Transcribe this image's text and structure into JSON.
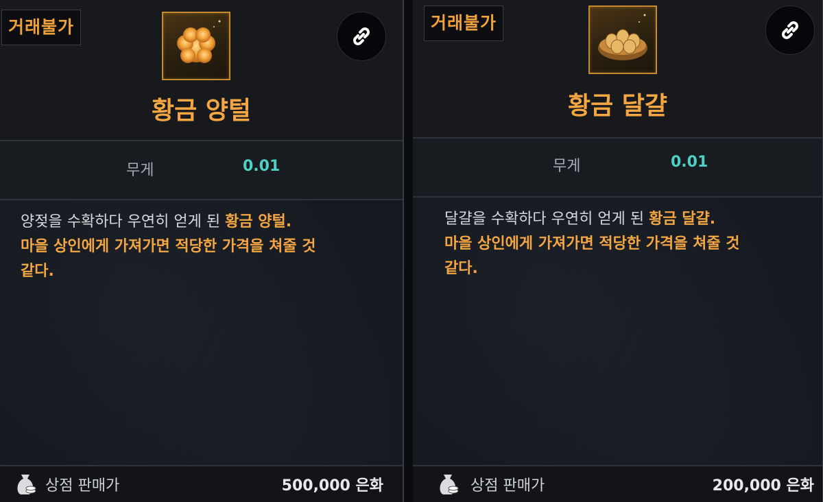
{
  "items": [
    {
      "badge": "거래불가",
      "icon": "golden-wool-icon",
      "name": "황금 양털",
      "stat_label": "무게",
      "stat_value": "0.01",
      "desc_line1_plain": "양젖을 수확하다 우연히 얻게 된 ",
      "desc_line1_hl": "황금 양털",
      "desc_line1_end": ".",
      "desc_line2": "마을 상인에게 가져가면 적당한 가격을 쳐줄 것",
      "desc_line3": "같다.",
      "price_label": "상점 판매가",
      "price": "500,000 은화"
    },
    {
      "badge": "거래불가",
      "icon": "golden-egg-basket-icon",
      "name": "황금 달걀",
      "stat_label": "무게",
      "stat_value": "0.01",
      "desc_line1_plain": "달걀을 수확하다 우연히 얻게 된 ",
      "desc_line1_hl": "황금 달걀",
      "desc_line1_end": ".",
      "desc_line2": "마을 상인에게 가져가면 적당한 가격을 쳐줄 것",
      "desc_line3": "같다.",
      "price_label": "상점 판매가",
      "price": "200,000 은화"
    }
  ],
  "colors": {
    "accent": "#f3a642",
    "value": "#4fd0c4",
    "panel": "#14171d"
  }
}
